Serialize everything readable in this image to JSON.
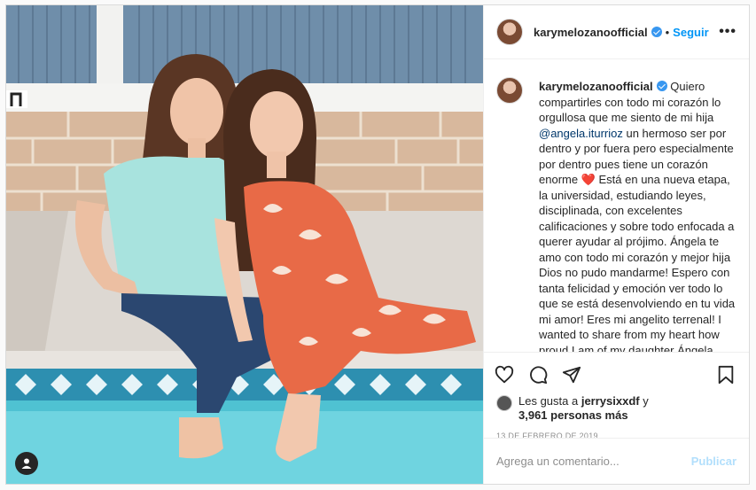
{
  "header": {
    "username": "karymelozanoofficial",
    "separator": "•",
    "follow_label": "Seguir",
    "more_label": "•••"
  },
  "caption": {
    "username": "karymelozanoofficial",
    "text_part1": "Quiero compartirles con todo mi corazón lo orgullosa que me siento de mi hija ",
    "mention": "@angela.iturrioz",
    "text_part2": " un hermoso ser por dentro y por fuera pero especialmente por dentro pues tiene un corazón enorme ",
    "emoji": "❤️",
    "text_part3": " Está en una nueva etapa, la universidad, estudiando leyes, disciplinada, con excelentes calificaciones y sobre todo enfocada a querer ayudar al prójimo. Ángela te amo con todo mi corazón y mejor hija Dios no pudo mandarme! Espero con tanta felicidad y emoción ver todo lo que se está desenvolviendo en tu vida mi amor! Eres mi angelito terrenal! I wanted to share from my heart how proud I am of my daughter Ángela. She is doing"
  },
  "likes": {
    "prefix": "Les gusta a ",
    "user": "jerrysixxdf",
    "joiner": " y",
    "count": "3,961 personas más"
  },
  "date": "13 DE FEBRERO DE 2019",
  "comment_box": {
    "placeholder": "Agrega un comentario...",
    "publish_label": "Publicar"
  },
  "colors": {
    "accent": "#0095f6",
    "publish_disabled": "#b2dffc",
    "muted": "#8e8e8e"
  },
  "icons": [
    "heart-icon",
    "comment-icon",
    "share-icon",
    "bookmark-icon",
    "user-tag-icon",
    "verified-badge-icon",
    "more-options-icon"
  ]
}
